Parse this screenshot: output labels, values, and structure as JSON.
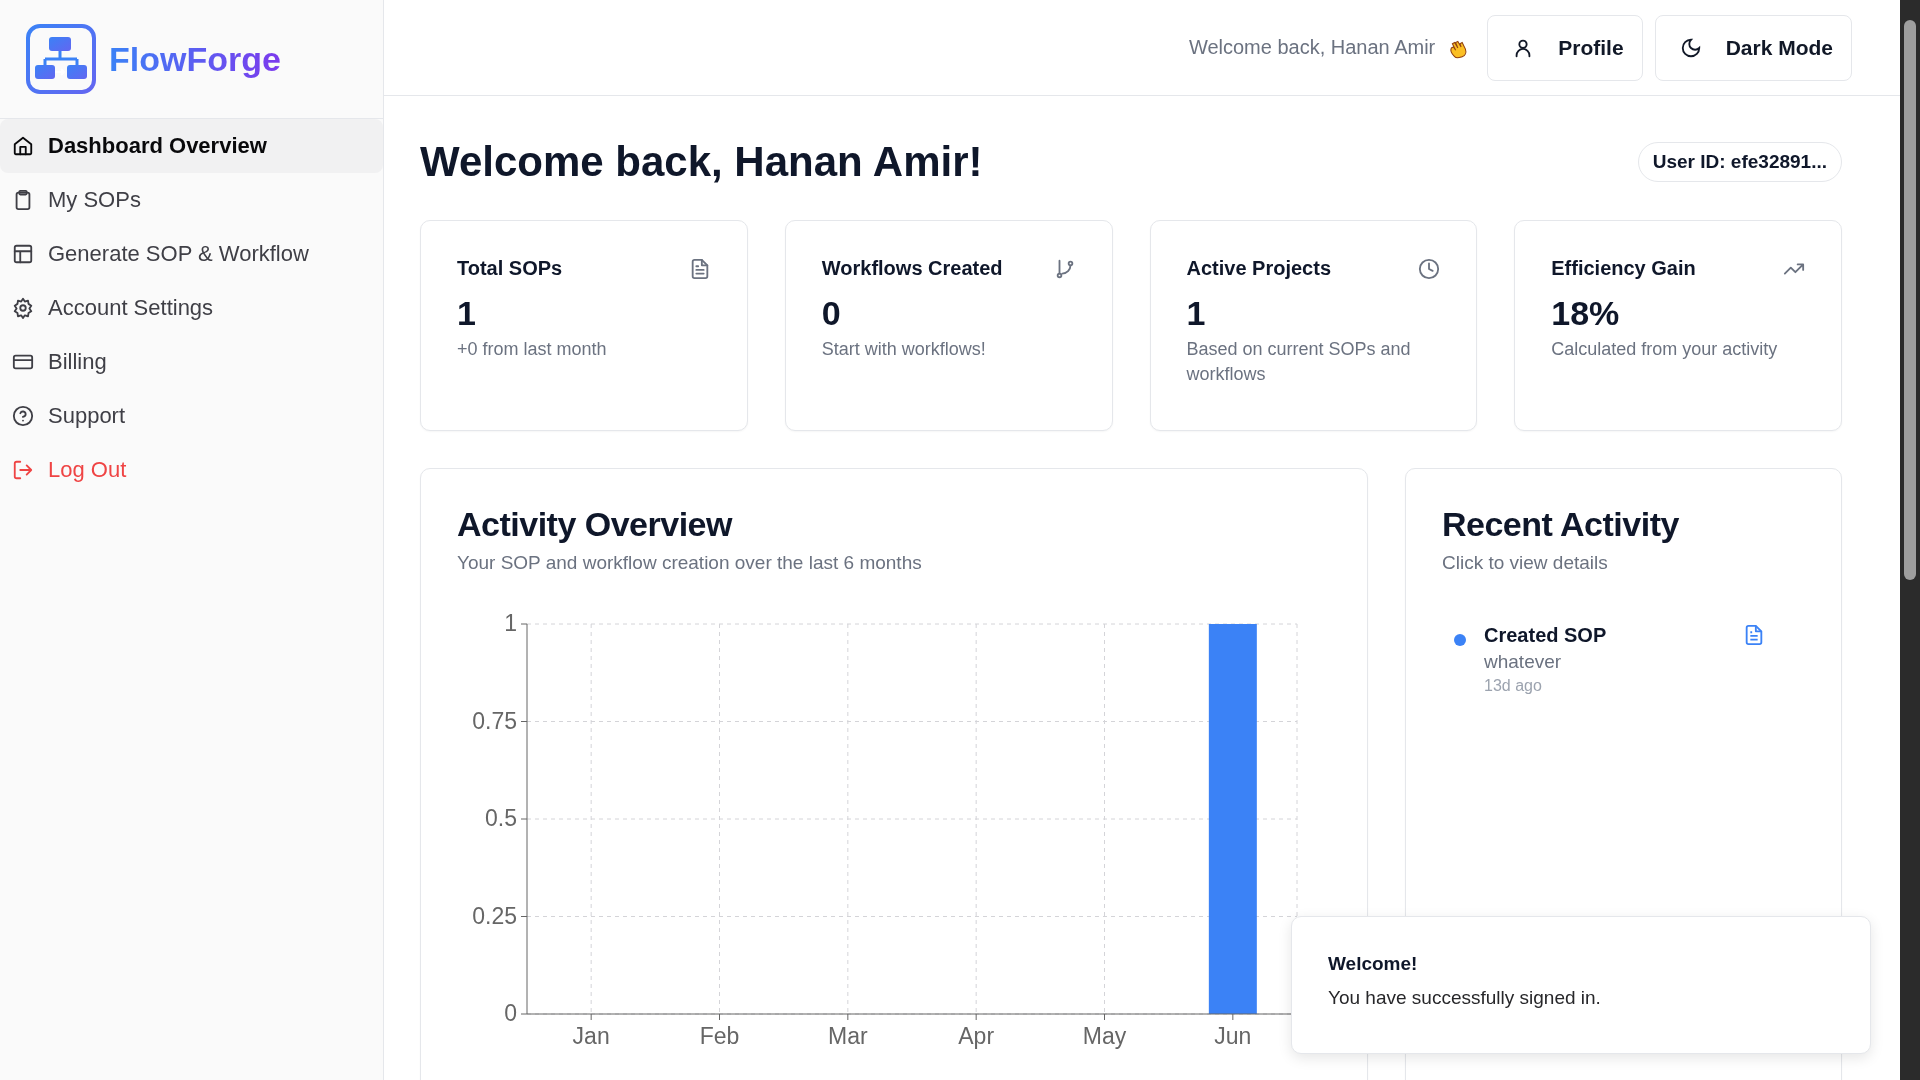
{
  "sidebar": {
    "logo": "FlowForge",
    "items": [
      {
        "label": "Dashboard Overview",
        "selected": true,
        "kind": "nav"
      },
      {
        "label": "My SOPs",
        "selected": false,
        "kind": "nav"
      },
      {
        "label": "Generate SOP & Workflow",
        "selected": false,
        "kind": "nav"
      },
      {
        "label": "Account Settings",
        "selected": false,
        "kind": "nav"
      },
      {
        "label": "Billing",
        "selected": false,
        "kind": "nav"
      },
      {
        "label": "Support",
        "selected": false,
        "kind": "nav"
      },
      {
        "label": "Log Out",
        "selected": false,
        "kind": "logout"
      }
    ]
  },
  "header": {
    "greeting": "Welcome back, Hanan Amir",
    "buttons": [
      "Profile",
      "Dark Mode"
    ]
  },
  "title": "Welcome back, Hanan Amir!",
  "user_id": "User ID: efe32891...",
  "stats": [
    {
      "title": "Total SOPs",
      "value": "1",
      "note": "+0 from last month"
    },
    {
      "title": "Workflows Created",
      "value": "0",
      "note": "Start with workflows!"
    },
    {
      "title": "Active Projects",
      "value": "1",
      "note": "Based on current SOPs and workflows"
    },
    {
      "title": "Efficiency Gain",
      "value": "18%",
      "note": "Calculated from your activity"
    }
  ],
  "activity_overview": {
    "title": "Activity Overview",
    "subtitle": "Your SOP and workflow creation over the last 6 months",
    "chart_data": {
      "type": "bar",
      "categories": [
        "Jan",
        "Feb",
        "Mar",
        "Apr",
        "May",
        "Jun"
      ],
      "series": [
        {
          "color": "#3b82f6",
          "values": [
            0,
            0,
            0,
            0,
            0,
            1
          ]
        }
      ],
      "grid": true,
      "ylim": [
        0,
        1
      ],
      "yticks": [
        0,
        {
          "value": 0.25,
          "label": "0.25"
        },
        {
          "value": 0.5,
          "label": "0.5"
        },
        {
          "value": 0.75,
          "label": "0.75"
        },
        1
      ]
    }
  },
  "recent_activity": {
    "title": "Recent Activity",
    "subtitle": "Click to view details",
    "items": [
      {
        "title": "Created SOP",
        "detail": "whatever",
        "time": "13d ago",
        "color": "#3b82f6"
      }
    ]
  },
  "toast": {
    "title": "Welcome!",
    "message": "You have successfully signed in."
  }
}
